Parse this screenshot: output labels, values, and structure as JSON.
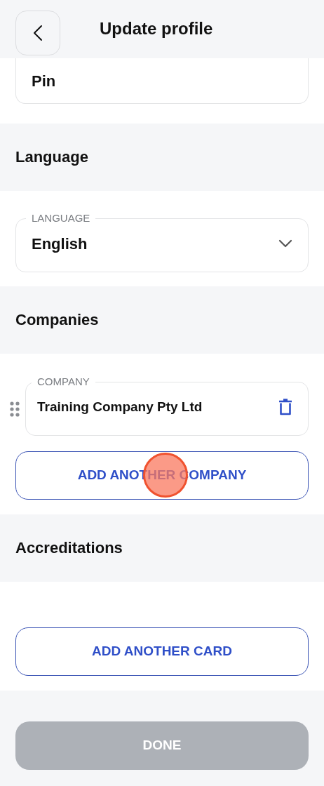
{
  "header": {
    "title": "Update profile"
  },
  "pin_field": {
    "value": "Pin"
  },
  "language_section": {
    "title": "Language",
    "field": {
      "label": "LANGUAGE",
      "value": "English"
    }
  },
  "companies_section": {
    "title": "Companies",
    "companies": [
      {
        "label": "COMPANY",
        "value": "Training Company Pty Ltd"
      }
    ],
    "add_button": "ADD ANOTHER COMPANY",
    "touch_indicator": true
  },
  "accreditations_section": {
    "title": "Accreditations",
    "add_button": "ADD ANOTHER CARD"
  },
  "done_button": {
    "label": "DONE",
    "disabled": true
  }
}
